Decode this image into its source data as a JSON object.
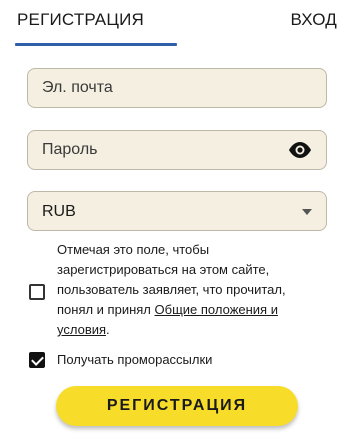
{
  "tabs": {
    "register_label": "РЕГИСТРАЦИЯ",
    "login_label": "ВХОД",
    "active": "register"
  },
  "form": {
    "email_placeholder": "Эл. почта",
    "email_value": "",
    "password_placeholder": "Пароль",
    "password_value": "",
    "password_toggle_icon": "eye-icon",
    "currency_value": "RUB",
    "currency_dropdown_icon": "caret-down-icon",
    "terms_text": "Отмечая это поле, чтобы зарегистрироваться на этом сайте, пользователь заявляет, что прочитал, понял и принял",
    "terms_link_text": "Общие положения и условия",
    "terms_suffix": ".",
    "terms_checked": false,
    "promo_label": "Получать проморассылки",
    "promo_checked": true,
    "submit_label": "РЕГИСТРАЦИЯ"
  },
  "colors": {
    "accent_blue": "#2f5fa8",
    "field_background": "#f4efe0",
    "button_yellow": "#f7dd2a"
  }
}
